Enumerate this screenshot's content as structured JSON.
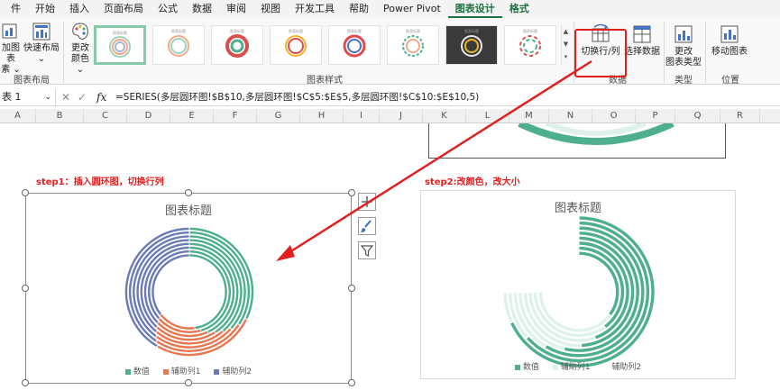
{
  "menu": {
    "tabs": [
      "件",
      "开始",
      "插入",
      "页面布局",
      "公式",
      "数据",
      "审阅",
      "视图",
      "开发工具",
      "帮助",
      "Power Pivot",
      "图表设计",
      "格式"
    ],
    "active_tab": "图表设计"
  },
  "ribbon": {
    "add_element_label": "加图表",
    "add_element_sub": "素 ⌄",
    "quick_layout_label": "快速布局",
    "quick_layout_sub": "⌄",
    "layout_group": "图表布局",
    "change_colors_label": "更改",
    "change_colors_sub": "颜色 ⌄",
    "styles_group": "图表样式",
    "switch_row_col": "切换行/列",
    "select_data": "选择数据",
    "data_group": "数据",
    "change_type_label": "更改",
    "change_type_sub": "图表类型",
    "type_group": "类型",
    "move_chart": "移动图表",
    "location_group": "位置",
    "style_thumb_title": "图表标题"
  },
  "formula_bar": {
    "name_box": "表 1",
    "fx": "fx",
    "formula": "=SERIES(多层圆环图!$B$10,多层圆环图!$C$5:$E$5,多层圆环图!$C$10:$E$10,5)"
  },
  "columns": [
    "A",
    "B",
    "C",
    "D",
    "E",
    "F",
    "G",
    "H",
    "I",
    "J",
    "K",
    "L",
    "M",
    "N",
    "O",
    "P",
    "Q",
    "R"
  ],
  "annotations": {
    "step1": "step1：插入圆环图，切换行列",
    "step2": "step2:改颜色，改大小"
  },
  "chart_left": {
    "title": "图表标题",
    "legend": [
      "数值",
      "辅助列1",
      "辅助列2"
    ]
  },
  "chart_right": {
    "title": "图表标题",
    "legend": [
      "数值",
      "辅助列1",
      "辅助列2"
    ]
  },
  "colors": {
    "green": "#4daf8c",
    "orange": "#e8764f",
    "blue": "#6b7bb6",
    "light_green": "#dff2e9",
    "accent": "#1e7145",
    "red": "#e02020"
  }
}
